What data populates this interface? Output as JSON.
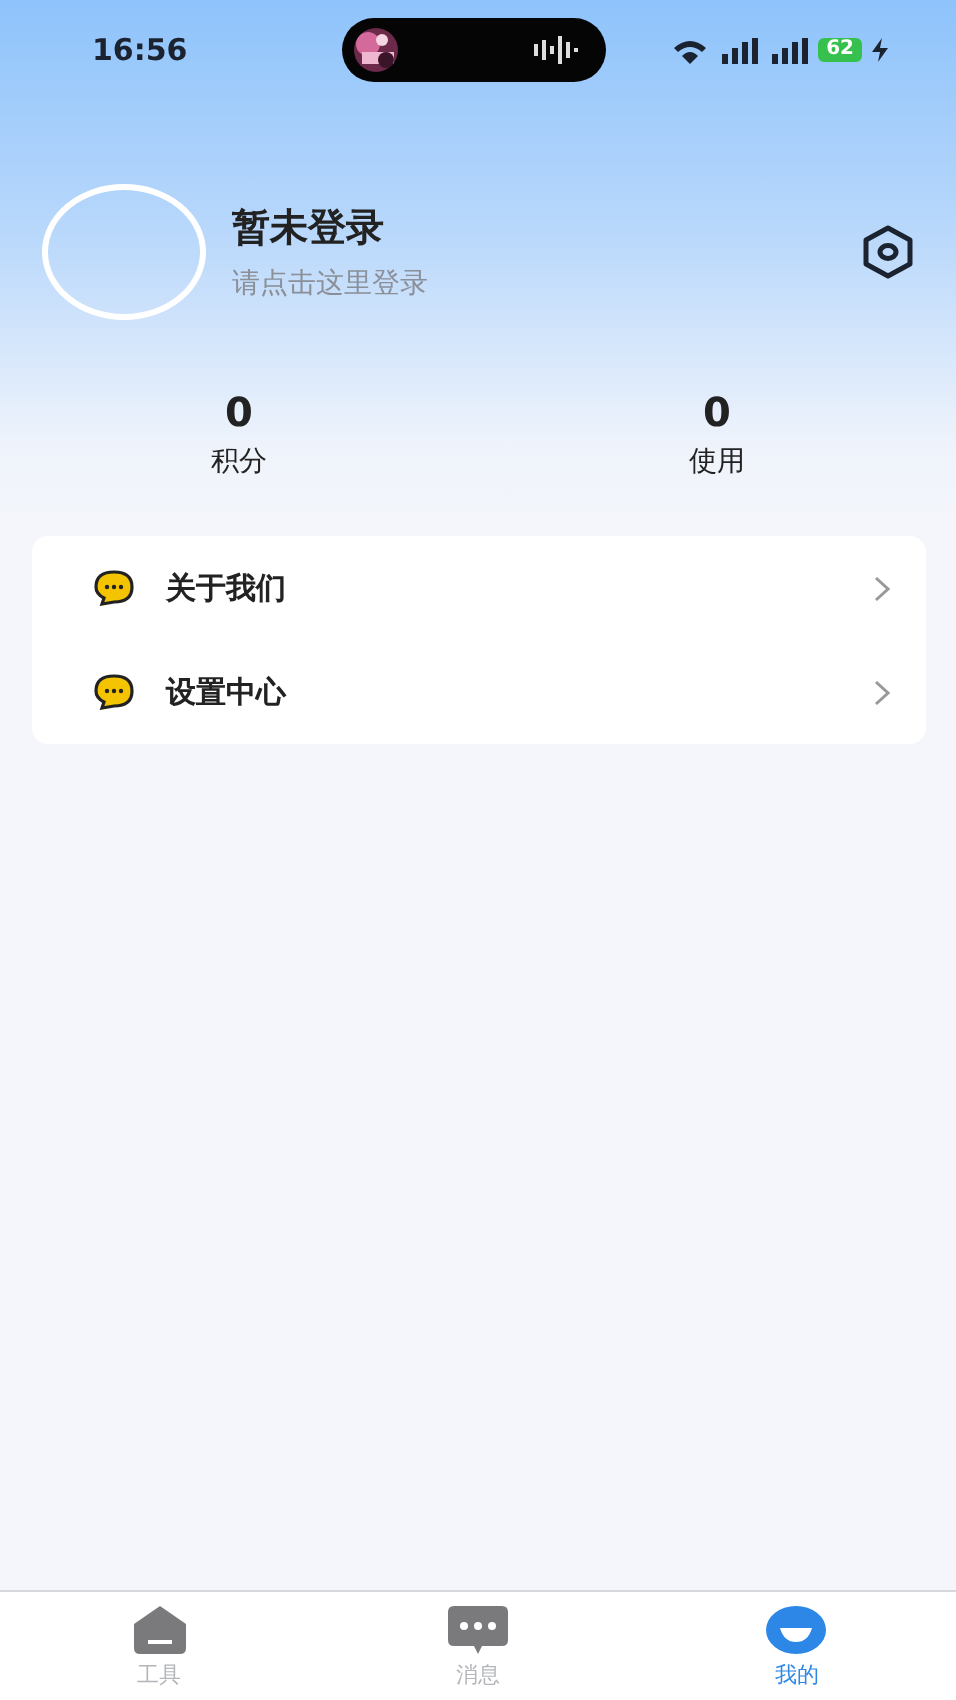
{
  "status_bar": {
    "time": "16:56",
    "battery": "62"
  },
  "profile": {
    "name": "暂未登录",
    "hint": "请点击这里登录"
  },
  "stats": [
    {
      "value": "0",
      "label": "积分"
    },
    {
      "value": "0",
      "label": "使用"
    }
  ],
  "menu": [
    {
      "label": "关于我们"
    },
    {
      "label": "设置中心"
    }
  ],
  "tab_bar": [
    {
      "label": "工具",
      "kind": "tools",
      "selected": false
    },
    {
      "label": "消息",
      "kind": "messages",
      "selected": false
    },
    {
      "label": "我的",
      "kind": "profile",
      "selected": true
    }
  ]
}
